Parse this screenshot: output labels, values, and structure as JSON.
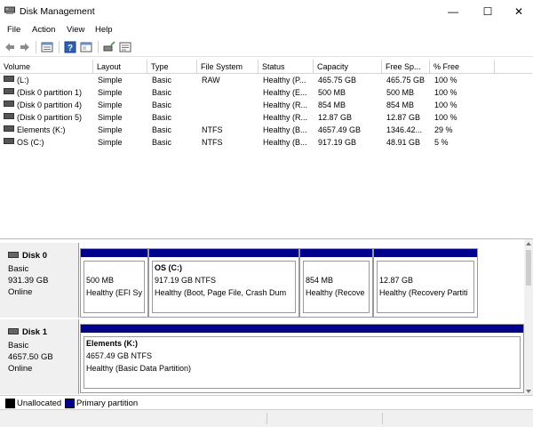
{
  "window": {
    "title": "Disk Management",
    "controls": {
      "minimize": "—",
      "maximize": "☐",
      "close": "✕"
    }
  },
  "menu": [
    "File",
    "Action",
    "View",
    "Help"
  ],
  "toolbar": [
    "back-icon",
    "forward-icon",
    "properties-icon",
    "help-icon",
    "show-pane-icon",
    "connect-icon",
    "settings-icon"
  ],
  "volumes": {
    "columns": [
      "Volume",
      "Layout",
      "Type",
      "File System",
      "Status",
      "Capacity",
      "Free Sp...",
      "% Free"
    ],
    "rows": [
      [
        "(L:)",
        "Simple",
        "Basic",
        "RAW",
        "Healthy (P...",
        "465.75 GB",
        "465.75 GB",
        "100 %"
      ],
      [
        "(Disk 0 partition 1)",
        "Simple",
        "Basic",
        "",
        "Healthy (E...",
        "500 MB",
        "500 MB",
        "100 %"
      ],
      [
        "(Disk 0 partition 4)",
        "Simple",
        "Basic",
        "",
        "Healthy (R...",
        "854 MB",
        "854 MB",
        "100 %"
      ],
      [
        "(Disk 0 partition 5)",
        "Simple",
        "Basic",
        "",
        "Healthy (R...",
        "12.87 GB",
        "12.87 GB",
        "100 %"
      ],
      [
        "Elements (K:)",
        "Simple",
        "Basic",
        "NTFS",
        "Healthy (B...",
        "4657.49 GB",
        "1346.42...",
        "29 %"
      ],
      [
        "OS (C:)",
        "Simple",
        "Basic",
        "NTFS",
        "Healthy (B...",
        "917.19 GB",
        "48.91 GB",
        "5 %"
      ]
    ]
  },
  "disks": [
    {
      "name": "Disk 0",
      "type": "Basic",
      "size": "931.39 GB",
      "state": "Online",
      "partitions": [
        {
          "title": "",
          "size": "500 MB",
          "status": "Healthy (EFI Sy"
        },
        {
          "title": "OS  (C:)",
          "size": "917.19 GB NTFS",
          "status": "Healthy (Boot, Page File, Crash Dum"
        },
        {
          "title": "",
          "size": "854 MB",
          "status": "Healthy (Recove"
        },
        {
          "title": "",
          "size": "12.87 GB",
          "status": "Healthy (Recovery Partiti"
        }
      ]
    },
    {
      "name": "Disk 1",
      "type": "Basic",
      "size": "4657.50 GB",
      "state": "Online",
      "partitions": [
        {
          "title": "Elements  (K:)",
          "size": "4657.49 GB NTFS",
          "status": "Healthy (Basic Data Partition)"
        }
      ]
    }
  ],
  "legend": [
    {
      "label": "Unallocated",
      "color": "#000000"
    },
    {
      "label": "Primary partition",
      "color": "#00008c"
    }
  ]
}
